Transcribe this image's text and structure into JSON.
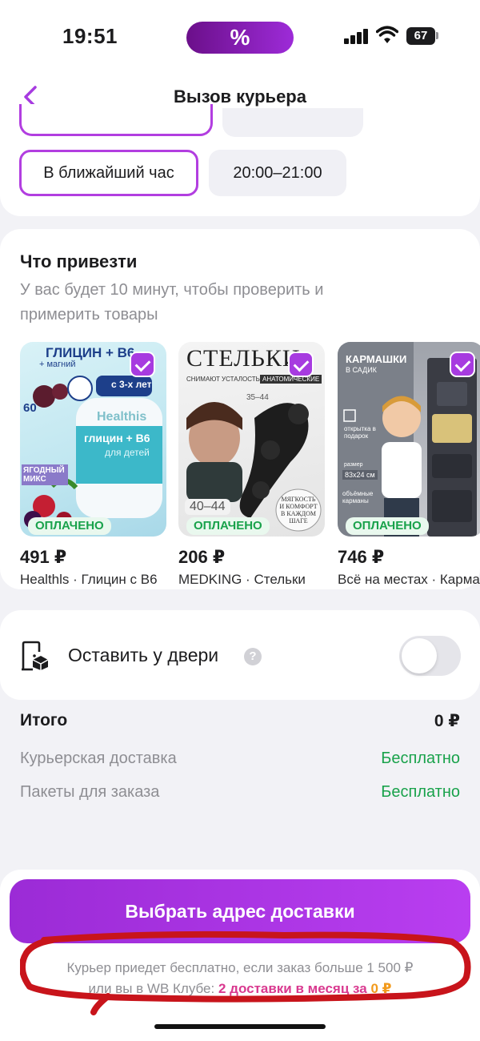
{
  "status_bar": {
    "time": "19:51",
    "badge": "%",
    "battery": "67"
  },
  "header": {
    "title": "Вызов курьера"
  },
  "time_slots": [
    {
      "label": "В ближайший час",
      "selected": true
    },
    {
      "label": "20:00–21:00",
      "selected": false
    }
  ],
  "items_section": {
    "title": "Что привезти",
    "subtitle": "У вас будет 10 минут, чтобы проверить и примерить товары",
    "products": [
      {
        "price": "491 ₽",
        "name": "Healthls · Глицин с В6",
        "badge": "ОПЛАЧЕНО",
        "img_text": [
          "ГЛИЦИН + В6",
          "+ магний",
          "с 3-х лет",
          "Healthis",
          "глицин + В6",
          "для детей",
          "60",
          "ЯГОДНЫЙ МИКС"
        ]
      },
      {
        "price": "206 ₽",
        "name": "MEDKING · Стельки",
        "badge": "ОПЛАЧЕНО",
        "img_text": [
          "СТЕЛЬКИ",
          "СНИМАЮТ УСТАЛОСТЬ",
          "АНАТОМИЧЕСКИЕ",
          "35–44",
          "40–44",
          "МЯГКОСТЬ И КОМФОРТ В КАЖДОМ ШАГЕ"
        ]
      },
      {
        "price": "746 ₽",
        "name": "Всё на местах · Кармашки",
        "badge": "ОПЛАЧЕНО",
        "img_text": [
          "КАРМАШКИ",
          "В САДИК",
          "открытка в подарок",
          "размер",
          "83x24 см",
          "объёмные карманы"
        ]
      }
    ]
  },
  "leave_at_door": {
    "label": "Оставить у двери",
    "help": "?",
    "enabled": false
  },
  "totals": {
    "total_label": "Итого",
    "total_value": "0 ₽",
    "rows": [
      {
        "label": "Курьерская доставка",
        "value": "Бесплатно"
      },
      {
        "label": "Пакеты для заказа",
        "value": "Бесплатно"
      }
    ]
  },
  "bottom": {
    "cta_label": "Выбрать адрес доставки",
    "note_line1": "Курьер приедет бесплатно, если заказ больше 1 500 ₽",
    "note_line2_prefix": "или вы в WB Клубе:",
    "note_accent": "2 доставки в месяц за",
    "note_accent_price": "0 ₽"
  },
  "colors": {
    "accent": "#a73be0",
    "success": "#19a24b",
    "annotation": "#c8141b"
  }
}
